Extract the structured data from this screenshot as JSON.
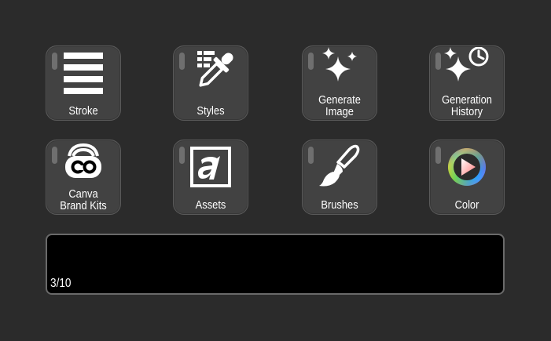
{
  "buttons": [
    {
      "id": "stroke",
      "label": "Stroke",
      "icon": "stroke-lines-icon"
    },
    {
      "id": "styles",
      "label": "Styles",
      "icon": "eyedropper-icon"
    },
    {
      "id": "generate-image",
      "label": "Generate\nImage",
      "icon": "sparkles-icon"
    },
    {
      "id": "generation-history",
      "label": "Generation\nHistory",
      "icon": "sparkles-clock-icon"
    },
    {
      "id": "canva-brand-kits",
      "label": "Canva\nBrand Kits",
      "icon": "canva-logo-icon"
    },
    {
      "id": "assets",
      "label": "Assets",
      "icon": "assets-a-icon"
    },
    {
      "id": "brushes",
      "label": "Brushes",
      "icon": "paintbrush-icon"
    },
    {
      "id": "color",
      "label": "Color",
      "icon": "color-wheel-icon"
    }
  ],
  "display": {
    "counter": "3/10"
  },
  "colors": {
    "background": "#2b2b2b",
    "tile": "#424242",
    "tile_border": "#5a5a5a",
    "indicator": "#6f6f6f",
    "display": "#000000"
  }
}
